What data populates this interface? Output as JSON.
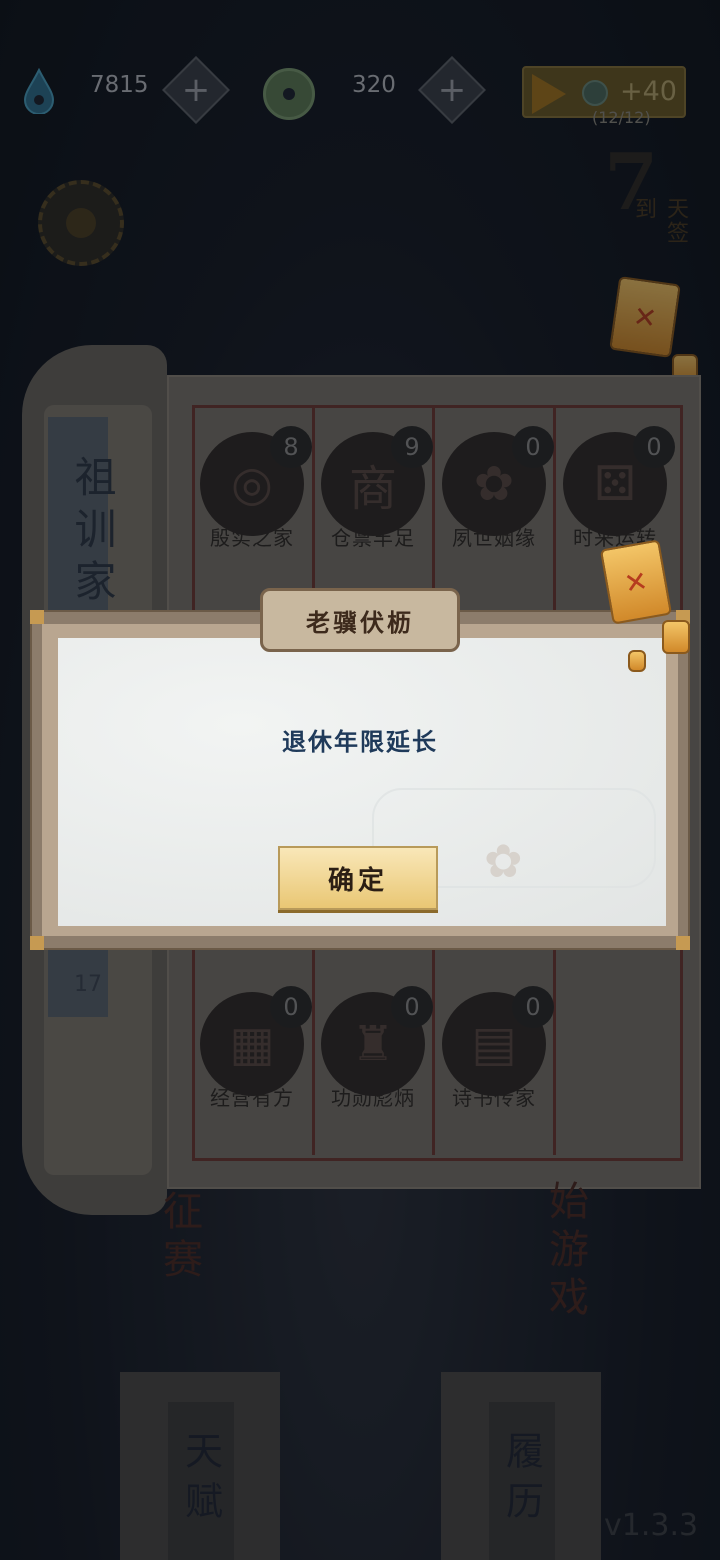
{
  "topbar": {
    "water_amount": "7815",
    "coin_amount": "320",
    "ad_reward": "+40",
    "ad_count": "(12/12)"
  },
  "checkin": {
    "number": "7",
    "label": "天签到"
  },
  "book": {
    "title": "祖训家",
    "page_number": "17",
    "tiles_top": [
      {
        "name": "殷实之家",
        "count": "8",
        "icon": "coins-icon"
      },
      {
        "name": "仓禀丰足",
        "count": "9",
        "glyph": "商",
        "icon": "shop-icon"
      },
      {
        "name": "夙世姻缘",
        "count": "0",
        "icon": "flower-icon"
      },
      {
        "name": "时来运转",
        "count": "0",
        "icon": "dice-icon"
      }
    ],
    "tiles_bottom": [
      {
        "name": "经营有方",
        "count": "0",
        "icon": "abacus-icon"
      },
      {
        "name": "功勋彪炳",
        "count": "0",
        "icon": "seal-icon"
      },
      {
        "name": "诗书传家",
        "count": "0",
        "icon": "book-icon"
      }
    ]
  },
  "background": {
    "left_banner": "征赛",
    "right_banner": "始游戏",
    "tab_talent": "天赋",
    "tab_history": "履历",
    "version": "v1.3.3"
  },
  "dialog": {
    "title": "老骥伏枥",
    "message": "退休年限延长",
    "confirm": "确定"
  },
  "colors": {
    "background": "#1c2431",
    "dialog_panel": "#e8ebea",
    "message_text": "#1f3a5a",
    "button_gold": "#e9c774"
  }
}
